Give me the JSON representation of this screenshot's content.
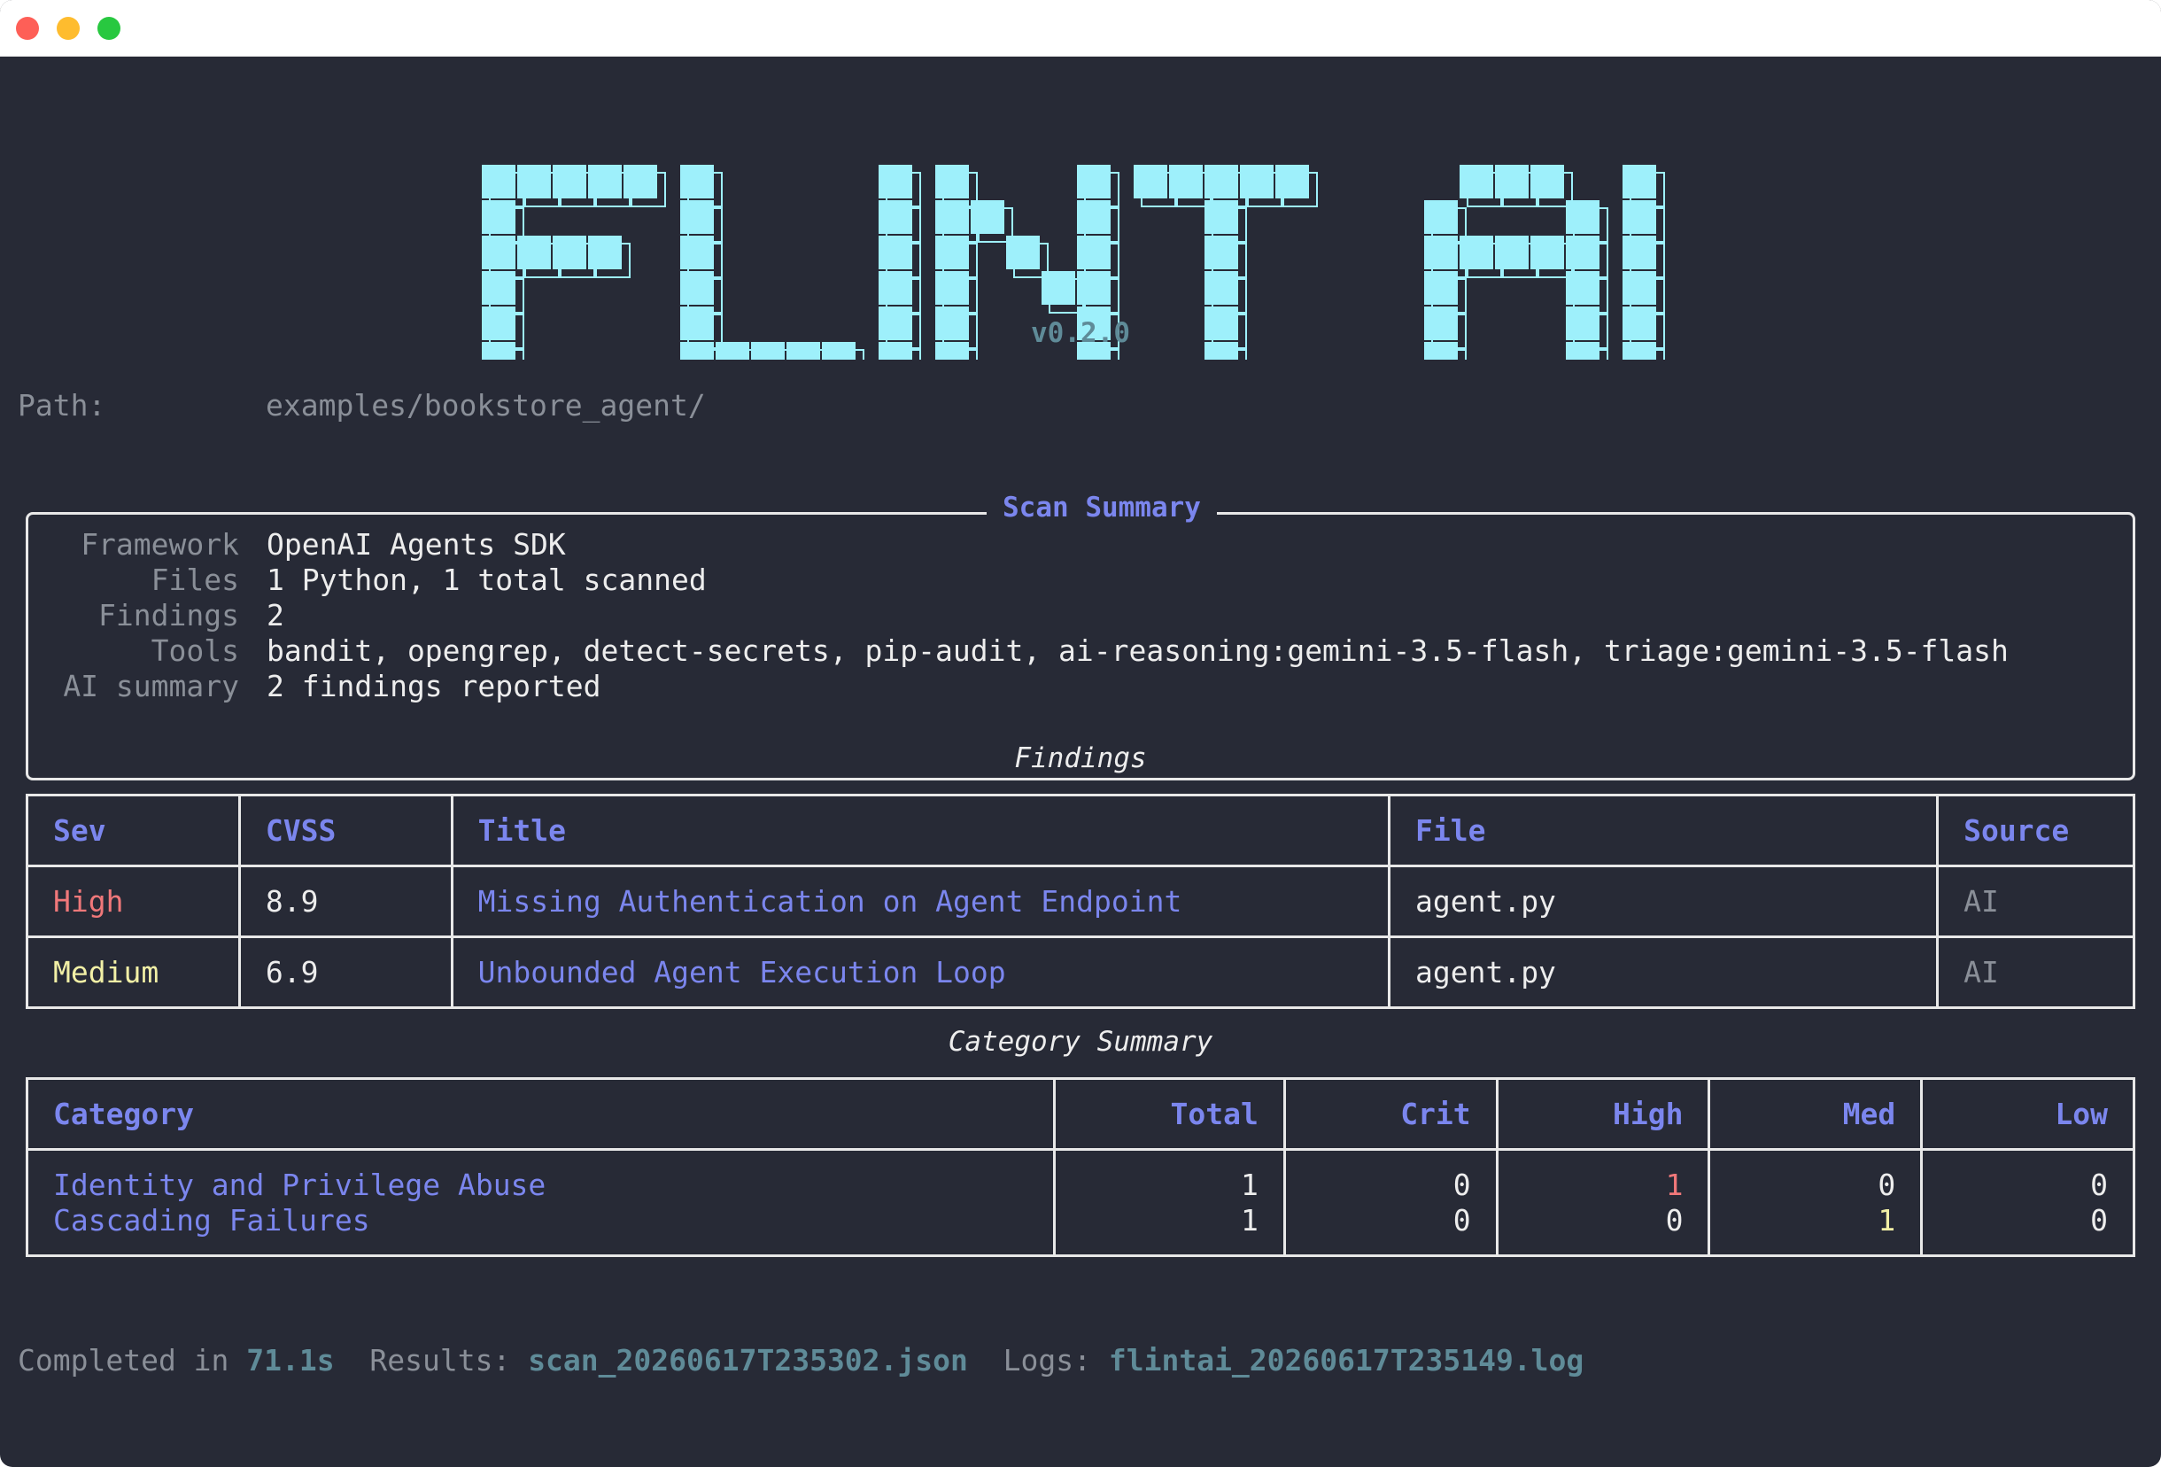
{
  "logo": {
    "text": "FLINT AI",
    "version": "v0.2.0",
    "color": "#9ef0fb"
  },
  "path": {
    "label": "Path:",
    "value": "examples/bookstore_agent/"
  },
  "scan_summary": {
    "title": "Scan Summary",
    "rows": [
      {
        "key": "Framework",
        "value": "OpenAI Agents SDK"
      },
      {
        "key": "Files",
        "value": "1 Python, 1 total scanned"
      },
      {
        "key": "Findings",
        "value": "2"
      },
      {
        "key": "Tools",
        "value": "bandit, opengrep, detect-secrets, pip-audit, ai-reasoning:gemini-3.5-flash, triage:gemini-3.5-flash"
      },
      {
        "key": "AI summary",
        "value": "2 findings reported"
      }
    ]
  },
  "findings": {
    "title": "Findings",
    "headers": [
      "Sev",
      "CVSS",
      "Title",
      "File",
      "Source"
    ],
    "rows": [
      {
        "sev": "High",
        "cvss": "8.9",
        "title": "Missing Authentication on Agent Endpoint",
        "file": "agent.py",
        "source": "AI"
      },
      {
        "sev": "Medium",
        "cvss": "6.9",
        "title": "Unbounded Agent Execution Loop",
        "file": "agent.py",
        "source": "AI"
      }
    ]
  },
  "category_summary": {
    "title": "Category Summary",
    "headers": [
      "Category",
      "Total",
      "Crit",
      "High",
      "Med",
      "Low"
    ],
    "rows": [
      {
        "category": "Identity and Privilege Abuse",
        "total": "1",
        "crit": "0",
        "high": "1",
        "med": "0",
        "low": "0"
      },
      {
        "category": "Cascading Failures",
        "total": "1",
        "crit": "0",
        "high": "0",
        "med": "1",
        "low": "0"
      }
    ]
  },
  "footer": {
    "completed_label": "Completed in ",
    "completed_value": "71.1s",
    "results_label": "Results: ",
    "results_value": "scan_20260617T235302.json",
    "logs_label": "Logs: ",
    "logs_value": "flintai_20260617T235149.log"
  },
  "colors": {
    "background": "#272a36",
    "accent": "#7b86ee",
    "high": "#f0787a",
    "medium": "#f2f0a6",
    "muted_teal": "#5f8b98"
  }
}
